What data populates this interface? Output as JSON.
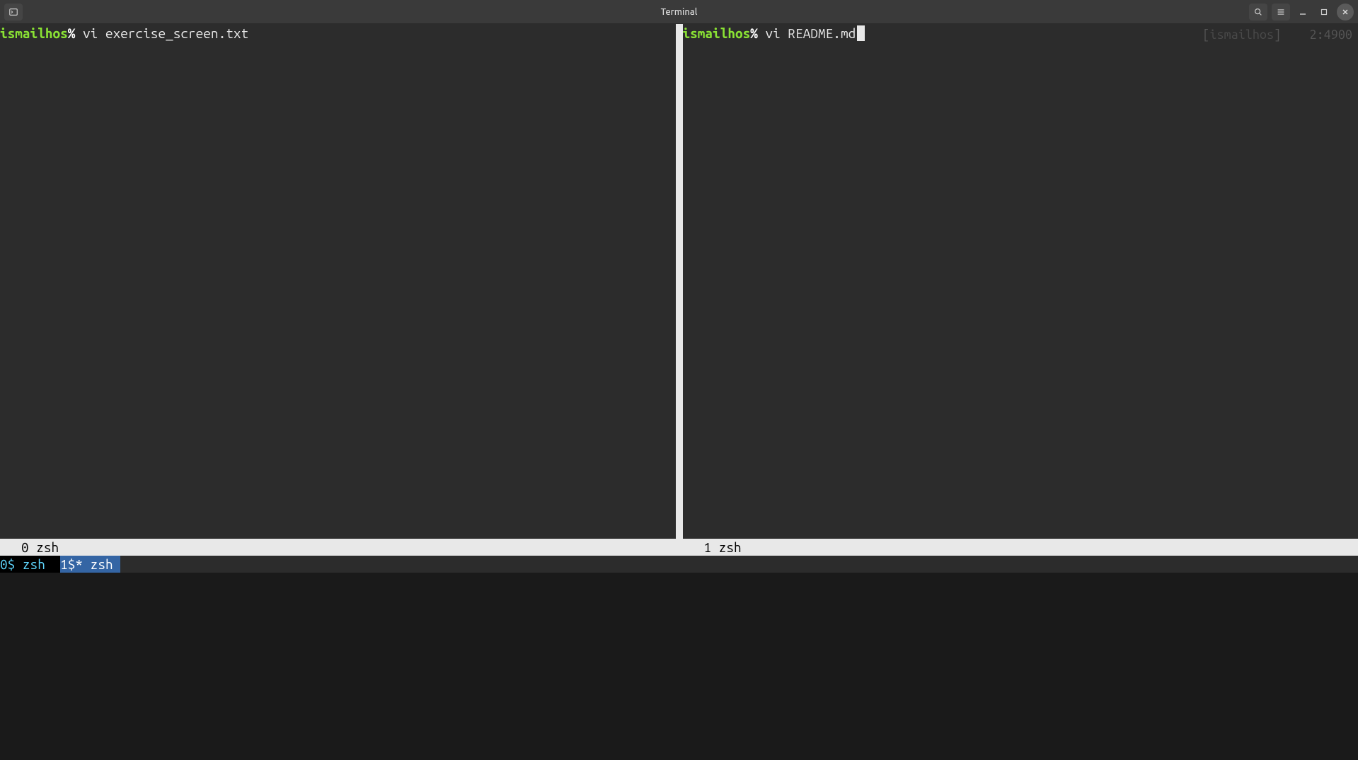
{
  "titlebar": {
    "title": "Terminal"
  },
  "panes": {
    "left": {
      "hostname": "ismailhos",
      "prompt_symbol": "%",
      "command": "vi exercise_screen.txt"
    },
    "right": {
      "hostname": "ismailhos",
      "prompt_symbol": "%",
      "command": "vi README.md",
      "info_name": "ismailhos",
      "info_value": "2:4900"
    }
  },
  "pane_status": {
    "left": "0 zsh",
    "right": "1 zsh"
  },
  "tmux": {
    "windows": [
      {
        "label": "0$ zsh  ",
        "active": false
      },
      {
        "label": "1$* zsh ",
        "active": true
      }
    ]
  }
}
